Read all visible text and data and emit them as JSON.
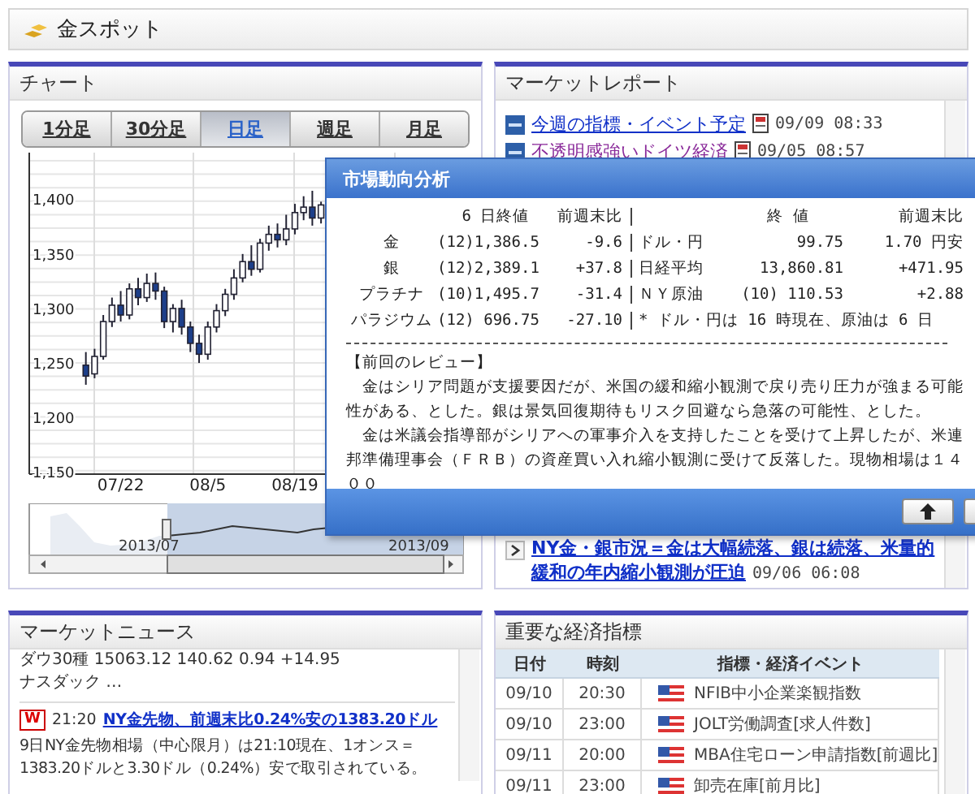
{
  "header": {
    "title": "金スポット"
  },
  "chart_panel": {
    "title": "チャート",
    "tabs": [
      {
        "label": "1分足",
        "selected": false
      },
      {
        "label": "30分足",
        "selected": false
      },
      {
        "label": "日足",
        "selected": true
      },
      {
        "label": "週足",
        "selected": false
      },
      {
        "label": "月足",
        "selected": false
      }
    ],
    "chart_data": {
      "type": "candlestick",
      "categories": [
        null,
        null,
        null,
        null,
        null,
        null,
        null,
        null,
        null,
        null,
        "07/22",
        null,
        null,
        null,
        null,
        null,
        null,
        null,
        null,
        null,
        "08/5",
        null,
        null,
        null,
        null,
        null,
        null,
        null,
        null,
        null,
        "08/19",
        null,
        null,
        null,
        null,
        null,
        null,
        null,
        null,
        null,
        null,
        null,
        null,
        null,
        null,
        null,
        null,
        null,
        null,
        null
      ],
      "ylim": [
        1150,
        1445
      ],
      "grid": true,
      "ohlc": [
        null,
        null,
        null,
        null,
        null,
        null,
        [
          1250,
          1262,
          1232,
          1240
        ],
        [
          1242,
          1265,
          1238,
          1258
        ],
        [
          1258,
          1296,
          1255,
          1290
        ],
        [
          1290,
          1312,
          1285,
          1305
        ],
        [
          1305,
          1318,
          1290,
          1296
        ],
        [
          1296,
          1325,
          1292,
          1320
        ],
        [
          1320,
          1330,
          1305,
          1312
        ],
        [
          1312,
          1334,
          1308,
          1325
        ],
        [
          1325,
          1335,
          1310,
          1318
        ],
        [
          1318,
          1322,
          1284,
          1290
        ],
        [
          1290,
          1306,
          1280,
          1302
        ],
        [
          1302,
          1310,
          1278,
          1285
        ],
        [
          1285,
          1290,
          1262,
          1270
        ],
        [
          1270,
          1278,
          1252,
          1260
        ],
        [
          1260,
          1290,
          1255,
          1285
        ],
        [
          1285,
          1306,
          1280,
          1300
        ],
        [
          1300,
          1320,
          1295,
          1315
        ],
        [
          1315,
          1338,
          1310,
          1330
        ],
        [
          1330,
          1352,
          1326,
          1345
        ],
        [
          1345,
          1360,
          1332,
          1338
        ],
        [
          1338,
          1366,
          1335,
          1362
        ],
        [
          1362,
          1378,
          1355,
          1370
        ],
        [
          1370,
          1380,
          1358,
          1365
        ],
        [
          1365,
          1388,
          1360,
          1375
        ],
        [
          1375,
          1398,
          1370,
          1390
        ],
        [
          1390,
          1405,
          1383,
          1395
        ],
        [
          1395,
          1410,
          1378,
          1385
        ],
        [
          1385,
          1400,
          1380,
          1397
        ],
        null,
        null,
        null,
        null,
        null,
        null,
        null,
        null,
        null,
        null,
        null,
        null,
        null,
        null,
        null,
        null
      ],
      "yticks": [
        {
          "value": 1400,
          "label": "1,400"
        },
        {
          "value": 1350,
          "label": "1,350"
        },
        {
          "value": 1300,
          "label": "1,300"
        },
        {
          "value": 1250,
          "label": "1,250"
        },
        {
          "value": 1200,
          "label": "1,200"
        },
        {
          "value": 1150,
          "label": "1,150"
        }
      ],
      "stacked": false
    },
    "navigator_labels": [
      "2013/07",
      "2013/09"
    ]
  },
  "market_report": {
    "title": "マーケットレポート",
    "items": [
      {
        "kind": "report",
        "title": "今週の指標・イベント予定",
        "time": "09/09 08:33",
        "visited": false
      },
      {
        "kind": "report",
        "title": "不透明感強いドイツ経済",
        "time": "09/05 08:57",
        "visited": true
      },
      {
        "kind": "news",
        "title": "NY金・銀市況＝金は大幅続落、銀は続落、米量的緩和の年内縮小観測が圧迫",
        "time": "09/06 06:08",
        "visited": false
      }
    ]
  },
  "dialog": {
    "title": "市場動向分析",
    "header": [
      "6 日終値",
      "前週末比",
      "終 値",
      "前週末比"
    ],
    "rows": [
      {
        "name": "金",
        "close": "(12)1,386.5",
        "change": "-9.6",
        "item": "ドル・円",
        "value": "99.75",
        "diff": "1.70 円安"
      },
      {
        "name": "銀",
        "close": "(12)2,389.1",
        "change": "+37.8",
        "item": "日経平均",
        "value": "13,860.81",
        "diff": "+471.95"
      },
      {
        "name": "プラチナ",
        "close": "(10)1,495.7",
        "change": "-31.4",
        "item": "ＮＹ原油",
        "value": "(10) 110.53",
        "diff": "+2.88"
      },
      {
        "name": "パラジウム",
        "close": "(12) 696.75",
        "change": "-27.10",
        "note": "* ドル・円は 16 時現在、原油は 6 日"
      }
    ],
    "review_title": "【前回のレビュー】",
    "paragraphs": [
      "　金はシリア問題が支援要因だが、米国の緩和縮小観測で戻り売り圧力が強まる可能性がある、とした。銀は景気回復期待もリスク回避なら急落の可能性、とした。",
      "　金は米議会指導部がシリアへの軍事介入を支持したことを受けて上昇したが、米連邦準備理事会（ＦＲＢ）の資産買い入れ縮小観測に受けて反落した。現物相場は１４００"
    ]
  },
  "market_news": {
    "title": "マーケットニュース",
    "lines": [
      "ダウ30種 15063.12 140.62 0.94 +14.95",
      "ナスダック …"
    ],
    "items": [
      {
        "badge": "W",
        "time": "21:20",
        "title": "NY金先物、前週末比0.24%安の1383.20ドル",
        "body": "9日NY金先物相場（中心限月）は21:10現在、1オンス＝1383.20ドルと3.30ドル（0.24%）安で取引されている。"
      }
    ]
  },
  "indicators": {
    "title": "重要な経済指標",
    "columns": [
      "日付",
      "時刻",
      "指標・経済イベント"
    ],
    "rows": [
      {
        "date": "09/10",
        "time": "20:30",
        "event": "NFIB中小企業楽観指数"
      },
      {
        "date": "09/10",
        "time": "23:00",
        "event": "JOLT労働調査[求人件数]"
      },
      {
        "date": "09/11",
        "time": "20:00",
        "event": "MBA住宅ローン申請指数[前週比]"
      },
      {
        "date": "09/11",
        "time": "23:00",
        "event": "卸売在庫[前月比]"
      }
    ]
  }
}
